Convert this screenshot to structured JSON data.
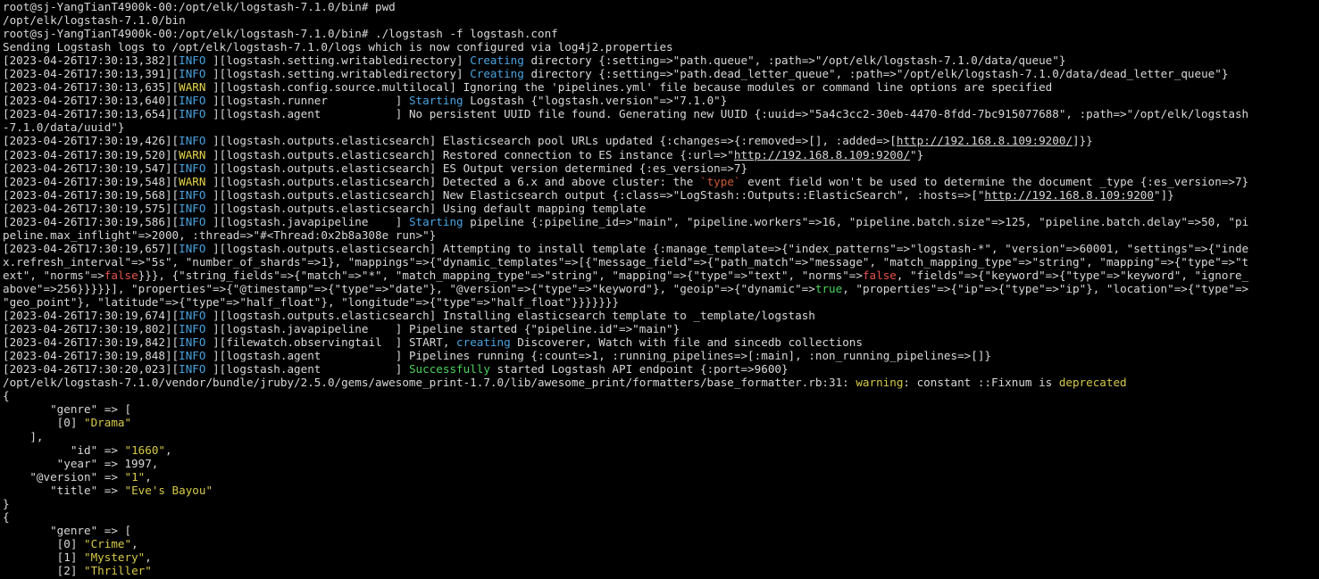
{
  "terminal": {
    "colors": {
      "background": "#000000",
      "foreground": "#d8d8d8",
      "info": "#4aa3df",
      "warn": "#e5d64d",
      "green": "#4cd25c",
      "red": "#e2534c",
      "string_yellow": "#d6c94a"
    },
    "lines": [
      [
        {
          "t": "root@sj-YangTianT4900k-00:/opt/elk/logstash-7.1.0/bin# pwd",
          "c": "default"
        }
      ],
      [
        {
          "t": "/opt/elk/logstash-7.1.0/bin",
          "c": "default"
        }
      ],
      [
        {
          "t": "root@sj-YangTianT4900k-00:/opt/elk/logstash-7.1.0/bin# ./logstash -f logstash.conf",
          "c": "default"
        }
      ],
      [
        {
          "t": "Sending Logstash logs to /opt/elk/logstash-7.1.0/logs which is now configured via log4j2.properties",
          "c": "default"
        }
      ],
      [
        {
          "t": "[2023-04-26T17:30:13,382][",
          "c": "default"
        },
        {
          "t": "INFO ",
          "c": "info"
        },
        {
          "t": "][logstash.setting.writabledirectory] ",
          "c": "default"
        },
        {
          "t": "Creating",
          "c": "info"
        },
        {
          "t": " directory {:setting=>\"path.queue\", :path=>\"/opt/elk/logstash-7.1.0/data/queue\"}",
          "c": "default"
        }
      ],
      [
        {
          "t": "[2023-04-26T17:30:13,391][",
          "c": "default"
        },
        {
          "t": "INFO ",
          "c": "info"
        },
        {
          "t": "][logstash.setting.writabledirectory] ",
          "c": "default"
        },
        {
          "t": "Creating",
          "c": "info"
        },
        {
          "t": " directory {:setting=>\"path.dead_letter_queue\", :path=>\"/opt/elk/logstash-7.1.0/data/dead_letter_queue\"}",
          "c": "default"
        }
      ],
      [
        {
          "t": "[2023-04-26T17:30:13,635][",
          "c": "default"
        },
        {
          "t": "WARN ",
          "c": "warn"
        },
        {
          "t": "][logstash.config.source.multilocal] Ignoring the 'pipelines.yml' file because modules or command line options are specified",
          "c": "default"
        }
      ],
      [
        {
          "t": "[2023-04-26T17:30:13,640][",
          "c": "default"
        },
        {
          "t": "INFO ",
          "c": "info"
        },
        {
          "t": "][logstash.runner          ] ",
          "c": "default"
        },
        {
          "t": "Starting",
          "c": "info"
        },
        {
          "t": " Logstash {\"logstash.version\"=>\"7.1.0\"}",
          "c": "default"
        }
      ],
      [
        {
          "t": "[2023-04-26T17:30:13,654][",
          "c": "default"
        },
        {
          "t": "INFO ",
          "c": "info"
        },
        {
          "t": "][logstash.agent           ] No persistent UUID file found. Generating new UUID {:uuid=>\"5a4c3cc2-30eb-4470-8fdd-7bc915077688\", :path=>\"/opt/elk/logstash",
          "c": "default"
        }
      ],
      [
        {
          "t": "-7.1.0/data/uuid\"}",
          "c": "default"
        }
      ],
      [
        {
          "t": "[2023-04-26T17:30:19,426][",
          "c": "default"
        },
        {
          "t": "INFO ",
          "c": "info"
        },
        {
          "t": "][logstash.outputs.elasticsearch] Elasticsearch pool URLs updated {:changes=>{:removed=>[], :added=>[",
          "c": "default"
        },
        {
          "t": "http://192.168.8.109:9200/",
          "c": "link"
        },
        {
          "t": "]}}",
          "c": "default"
        }
      ],
      [
        {
          "t": "[2023-04-26T17:30:19,520][",
          "c": "default"
        },
        {
          "t": "WARN ",
          "c": "warn"
        },
        {
          "t": "][logstash.outputs.elasticsearch] Restored connection to ES instance {:url=>\"",
          "c": "default"
        },
        {
          "t": "http://192.168.8.109:9200/",
          "c": "link"
        },
        {
          "t": "\"}",
          "c": "default"
        }
      ],
      [
        {
          "t": "[2023-04-26T17:30:19,547][",
          "c": "default"
        },
        {
          "t": "INFO ",
          "c": "info"
        },
        {
          "t": "][logstash.outputs.elasticsearch] ES Output version determined {:es_version=>7}",
          "c": "default"
        }
      ],
      [
        {
          "t": "[2023-04-26T17:30:19,548][",
          "c": "default"
        },
        {
          "t": "WARN ",
          "c": "warn"
        },
        {
          "t": "][logstash.outputs.elasticsearch] Detected a 6.x and above cluster: the ",
          "c": "default"
        },
        {
          "t": "`type`",
          "c": "tick"
        },
        {
          "t": " event field won't be used to determine the document _type {:es_version=>7}",
          "c": "default"
        }
      ],
      [
        {
          "t": "[2023-04-26T17:30:19,568][",
          "c": "default"
        },
        {
          "t": "INFO ",
          "c": "info"
        },
        {
          "t": "][logstash.outputs.elasticsearch] New Elasticsearch output {:class=>\"LogStash::Outputs::ElasticSearch\", :hosts=>[\"",
          "c": "default"
        },
        {
          "t": "http://192.168.8.109:9200",
          "c": "link"
        },
        {
          "t": "\"]}",
          "c": "default"
        }
      ],
      [
        {
          "t": "[2023-04-26T17:30:19,575][",
          "c": "default"
        },
        {
          "t": "INFO ",
          "c": "info"
        },
        {
          "t": "][logstash.outputs.elasticsearch] Using default mapping template",
          "c": "default"
        }
      ],
      [
        {
          "t": "[2023-04-26T17:30:19,586][",
          "c": "default"
        },
        {
          "t": "INFO ",
          "c": "info"
        },
        {
          "t": "][logstash.javapipeline    ] ",
          "c": "default"
        },
        {
          "t": "Starting",
          "c": "info"
        },
        {
          "t": " pipeline {:pipeline_id=>\"main\", \"pipeline.workers\"=>16, \"pipeline.batch.size\"=>125, \"pipeline.batch.delay\"=>50, \"pi",
          "c": "default"
        }
      ],
      [
        {
          "t": "peline.max_inflight\"=>2000, :thread=>\"#<Thread:0x2b8a308e run>\"}",
          "c": "default"
        }
      ],
      [
        {
          "t": "[2023-04-26T17:30:19,657][",
          "c": "default"
        },
        {
          "t": "INFO ",
          "c": "info"
        },
        {
          "t": "][logstash.outputs.elasticsearch] Attempting to install template {:manage_template=>{\"index_patterns\"=>\"logstash-*\", \"version\"=>60001, \"settings\"=>{\"inde",
          "c": "default"
        }
      ],
      [
        {
          "t": "x.refresh_interval\"=>\"5s\", \"number_of_shards\"=>1}, \"mappings\"=>{\"dynamic_templates\"=>[{\"message_field\"=>{\"path_match\"=>\"message\", \"match_mapping_type\"=>\"string\", \"mapping\"=>{\"type\"=>\"t",
          "c": "default"
        }
      ],
      [
        {
          "t": "ext\", \"norms\"=>",
          "c": "default"
        },
        {
          "t": "false",
          "c": "red"
        },
        {
          "t": "}}}, {\"string_fields\"=>{\"match\"=>\"*\", \"match_mapping_type\"=>\"string\", \"mapping\"=>{\"type\"=>\"text\", \"norms\"=>",
          "c": "default"
        },
        {
          "t": "false",
          "c": "red"
        },
        {
          "t": ", \"fields\"=>{\"keyword\"=>{\"type\"=>\"keyword\", \"ignore_",
          "c": "default"
        }
      ],
      [
        {
          "t": "above\"=>256}}}}}], \"properties\"=>{\"@timestamp\"=>{\"type\"=>\"date\"}, \"@version\"=>{\"type\"=>\"keyword\"}, \"geoip\"=>{\"dynamic\"=>",
          "c": "default"
        },
        {
          "t": "true",
          "c": "green"
        },
        {
          "t": ", \"properties\"=>{\"ip\"=>{\"type\"=>\"ip\"}, \"location\"=>{\"type\"=>",
          "c": "default"
        }
      ],
      [
        {
          "t": "\"geo_point\"}, \"latitude\"=>{\"type\"=>\"half_float\"}, \"longitude\"=>{\"type\"=>\"half_float\"}}}}}}}",
          "c": "default"
        }
      ],
      [
        {
          "t": "[2023-04-26T17:30:19,674][",
          "c": "default"
        },
        {
          "t": "INFO ",
          "c": "info"
        },
        {
          "t": "][logstash.outputs.elasticsearch] Installing elasticsearch template to _template/logstash",
          "c": "default"
        }
      ],
      [
        {
          "t": "[2023-04-26T17:30:19,802][",
          "c": "default"
        },
        {
          "t": "INFO ",
          "c": "info"
        },
        {
          "t": "][logstash.javapipeline    ] Pipeline started {\"pipeline.id\"=>\"main\"}",
          "c": "default"
        }
      ],
      [
        {
          "t": "[2023-04-26T17:30:19,842][",
          "c": "default"
        },
        {
          "t": "INFO ",
          "c": "info"
        },
        {
          "t": "][filewatch.observingtail  ] START, ",
          "c": "default"
        },
        {
          "t": "creating",
          "c": "info"
        },
        {
          "t": " Discoverer, Watch with file and sincedb collections",
          "c": "default"
        }
      ],
      [
        {
          "t": "[2023-04-26T17:30:19,848][",
          "c": "default"
        },
        {
          "t": "INFO ",
          "c": "info"
        },
        {
          "t": "][logstash.agent           ] Pipelines running {:count=>1, :running_pipelines=>[:main], :non_running_pipelines=>[]}",
          "c": "default"
        }
      ],
      [
        {
          "t": "[2023-04-26T17:30:20,023][",
          "c": "default"
        },
        {
          "t": "INFO ",
          "c": "info"
        },
        {
          "t": "][logstash.agent           ] ",
          "c": "default"
        },
        {
          "t": "Successfully",
          "c": "green"
        },
        {
          "t": " started Logstash API endpoint {:port=>9600}",
          "c": "default"
        }
      ],
      [
        {
          "t": "/opt/elk/logstash-7.1.0/vendor/bundle/jruby/2.5.0/gems/awesome_print-1.7.0/lib/awesome_print/formatters/base_formatter.rb:31: ",
          "c": "default"
        },
        {
          "t": "warning",
          "c": "yellow"
        },
        {
          "t": ": constant ::Fixnum is ",
          "c": "default"
        },
        {
          "t": "deprecated",
          "c": "yellow"
        }
      ],
      [
        {
          "t": "{",
          "c": "default"
        }
      ],
      [
        {
          "t": "       \"genre\" => [",
          "c": "default"
        }
      ],
      [
        {
          "t": "        [0] ",
          "c": "default"
        },
        {
          "t": "\"Drama\"",
          "c": "yellow"
        }
      ],
      [
        {
          "t": "    ],",
          "c": "default"
        }
      ],
      [
        {
          "t": "          \"id\" => ",
          "c": "default"
        },
        {
          "t": "\"1660\"",
          "c": "yellow"
        },
        {
          "t": ",",
          "c": "default"
        }
      ],
      [
        {
          "t": "        \"year\" => 1997,",
          "c": "default"
        }
      ],
      [
        {
          "t": "    \"@version\" => ",
          "c": "default"
        },
        {
          "t": "\"1\"",
          "c": "yellow"
        },
        {
          "t": ",",
          "c": "default"
        }
      ],
      [
        {
          "t": "       \"title\" => ",
          "c": "default"
        },
        {
          "t": "\"Eve's Bayou\"",
          "c": "yellow"
        }
      ],
      [
        {
          "t": "}",
          "c": "default"
        }
      ],
      [
        {
          "t": "{",
          "c": "default"
        }
      ],
      [
        {
          "t": "       \"genre\" => [",
          "c": "default"
        }
      ],
      [
        {
          "t": "        [0] ",
          "c": "default"
        },
        {
          "t": "\"Crime\"",
          "c": "yellow"
        },
        {
          "t": ",",
          "c": "default"
        }
      ],
      [
        {
          "t": "        [1] ",
          "c": "default"
        },
        {
          "t": "\"Mystery\"",
          "c": "yellow"
        },
        {
          "t": ",",
          "c": "default"
        }
      ],
      [
        {
          "t": "        [2] ",
          "c": "default"
        },
        {
          "t": "\"Thriller\"",
          "c": "yellow"
        }
      ]
    ]
  }
}
